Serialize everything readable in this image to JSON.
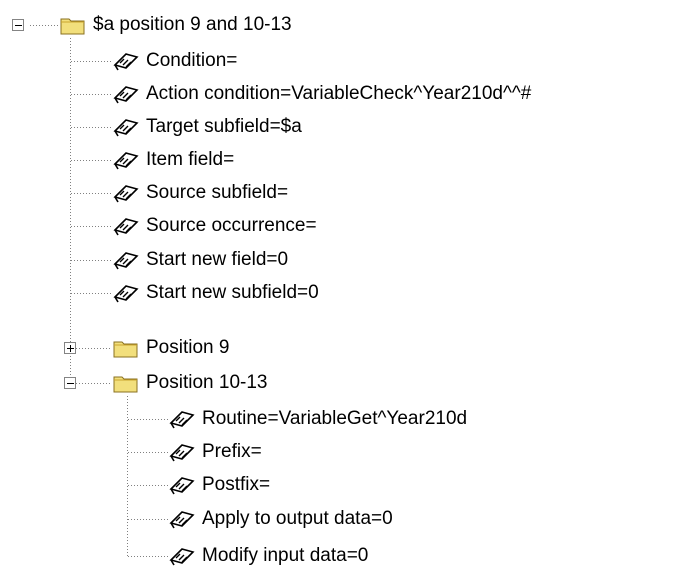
{
  "tree": {
    "root": {
      "label": "$a position 9 and 10-13",
      "expanded": true,
      "icon": "folder-icon",
      "children": [
        {
          "label": "Condition=",
          "icon": "properties-icon"
        },
        {
          "label": "Action condition=VariableCheck^Year210d^^#",
          "icon": "properties-icon"
        },
        {
          "label": "Target subfield=$a",
          "icon": "properties-icon"
        },
        {
          "label": "Item field=",
          "icon": "properties-icon"
        },
        {
          "label": "Source subfield=",
          "icon": "properties-icon"
        },
        {
          "label": "Source occurrence=",
          "icon": "properties-icon"
        },
        {
          "label": "Start new field=0",
          "icon": "properties-icon"
        },
        {
          "label": "Start new subfield=0",
          "icon": "properties-icon"
        },
        {
          "label": "Position 9",
          "icon": "folder-icon",
          "expanded": false
        },
        {
          "label": "Position 10-13",
          "icon": "folder-icon",
          "expanded": true,
          "children": [
            {
              "label": "Routine=VariableGet^Year210d",
              "icon": "properties-icon"
            },
            {
              "label": "Prefix=",
              "icon": "properties-icon"
            },
            {
              "label": "Postfix=",
              "icon": "properties-icon"
            },
            {
              "label": "Apply to output data=0",
              "icon": "properties-icon"
            },
            {
              "label": "Modify input data=0",
              "icon": "properties-icon"
            }
          ]
        }
      ]
    }
  },
  "colors": {
    "folder_fill": "#f2df7c",
    "folder_dark": "#c9a52e",
    "connector": "#808080",
    "properties_fill": "#ffffff"
  }
}
